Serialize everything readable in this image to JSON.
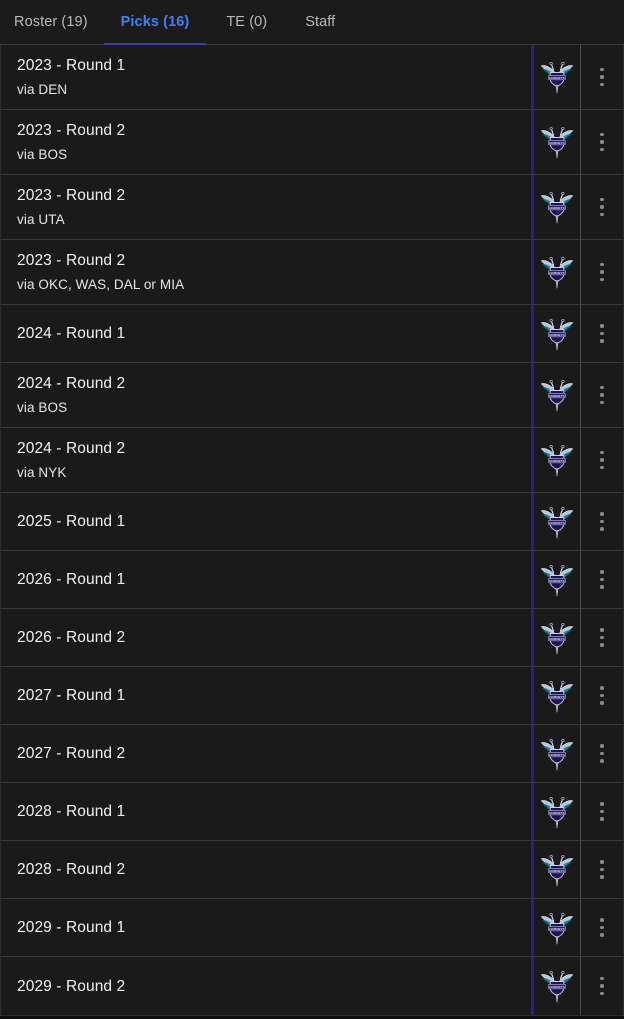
{
  "theme": {
    "page_bg": "#0f0f0f",
    "row_bg": "#1a1a1a",
    "tabbar_bg": "#1b1b1b",
    "divider": "#3a3a3a",
    "active_tab_color": "#3b82f6",
    "active_tab_underline": "#3b3bb5",
    "logo_accent_bar": "#2a1f8f",
    "text_primary": "#f2f2f2",
    "text_secondary": "#e6e6e6",
    "tab_inactive": "#b9b9b9",
    "kebab_dot": "#8a8a8a"
  },
  "tabs": [
    {
      "label": "Roster (19)",
      "active": false,
      "name": "tab-roster"
    },
    {
      "label": "Picks (16)",
      "active": true,
      "name": "tab-picks"
    },
    {
      "label": "TE (0)",
      "active": false,
      "name": "tab-te"
    },
    {
      "label": "Staff",
      "active": false,
      "name": "tab-staff"
    }
  ],
  "team": {
    "name": "Charlotte Hornets",
    "logo_icon": "hornets-logo-icon",
    "primary": "#1d1160",
    "secondary": "#00788c",
    "accent": "#a1a1a4"
  },
  "menu_icon": "kebab-menu-icon",
  "picks": [
    {
      "title": "2023 - Round 1",
      "via": "via DEN"
    },
    {
      "title": "2023 - Round 2",
      "via": "via BOS"
    },
    {
      "title": "2023 - Round 2",
      "via": "via UTA"
    },
    {
      "title": "2023 - Round 2",
      "via": "via OKC, WAS, DAL or MIA"
    },
    {
      "title": "2024 - Round 1",
      "via": ""
    },
    {
      "title": "2024 - Round 2",
      "via": "via BOS"
    },
    {
      "title": "2024 - Round 2",
      "via": "via NYK"
    },
    {
      "title": "2025 - Round 1",
      "via": ""
    },
    {
      "title": "2026 - Round 1",
      "via": ""
    },
    {
      "title": "2026 - Round 2",
      "via": ""
    },
    {
      "title": "2027 - Round 1",
      "via": ""
    },
    {
      "title": "2027 - Round 2",
      "via": ""
    },
    {
      "title": "2028 - Round 1",
      "via": ""
    },
    {
      "title": "2028 - Round 2",
      "via": ""
    },
    {
      "title": "2029 - Round 1",
      "via": ""
    },
    {
      "title": "2029 - Round 2",
      "via": ""
    }
  ]
}
